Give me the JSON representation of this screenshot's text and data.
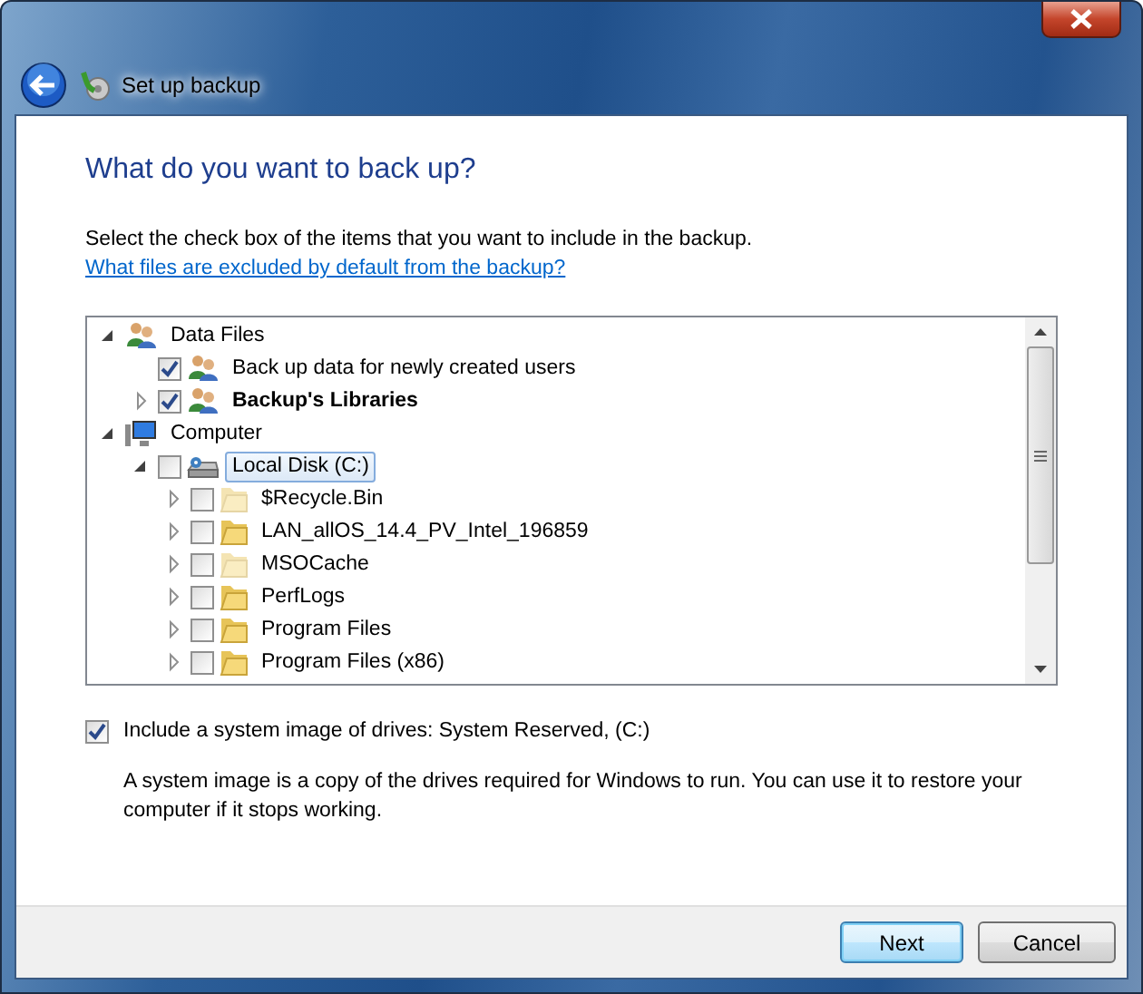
{
  "window": {
    "title": "Set up backup"
  },
  "heading": "What do you want to back up?",
  "description": "Select the check box of the items that you want to include in the backup.",
  "description_link": "What files are excluded by default from the backup?",
  "tree": [
    {
      "label": "Data Files",
      "kind": "users-category",
      "expanded": true,
      "selected": false,
      "children": [
        {
          "label": "Back up data for newly created users",
          "kind": "users",
          "checked": true,
          "selected": false
        },
        {
          "label": "Backup's Libraries",
          "kind": "users",
          "bold": true,
          "expanded": false,
          "checked": true,
          "selected": false
        }
      ]
    },
    {
      "label": "Computer",
      "kind": "computer",
      "expanded": true,
      "selected": false,
      "children": [
        {
          "label": "Local Disk (C:)",
          "kind": "drive",
          "expanded": true,
          "checked": false,
          "selected": true,
          "children": [
            {
              "label": "$Recycle.Bin",
              "kind": "folder",
              "hidden": true,
              "expanded": false,
              "checked": false,
              "selected": false
            },
            {
              "label": "LAN_allOS_14.4_PV_Intel_196859",
              "kind": "folder",
              "hidden": false,
              "expanded": false,
              "checked": false,
              "selected": false
            },
            {
              "label": "MSOCache",
              "kind": "folder",
              "hidden": true,
              "expanded": false,
              "checked": false,
              "selected": false
            },
            {
              "label": "PerfLogs",
              "kind": "folder",
              "hidden": false,
              "expanded": false,
              "checked": false,
              "selected": false
            },
            {
              "label": "Program Files",
              "kind": "folder",
              "hidden": false,
              "expanded": false,
              "checked": false,
              "selected": false
            },
            {
              "label": "Program Files (x86)",
              "kind": "folder",
              "hidden": false,
              "expanded": false,
              "checked": false,
              "selected": false
            }
          ]
        }
      ]
    }
  ],
  "system_image": {
    "label": "Include a system image of drives: System Reserved, (C:)",
    "checked": true,
    "note": "A system image is a copy of the drives required for Windows to run. You can use it to restore your computer if it stops working."
  },
  "buttons": [
    {
      "label": "Next",
      "default": true
    },
    {
      "label": "Cancel",
      "default": false
    }
  ]
}
